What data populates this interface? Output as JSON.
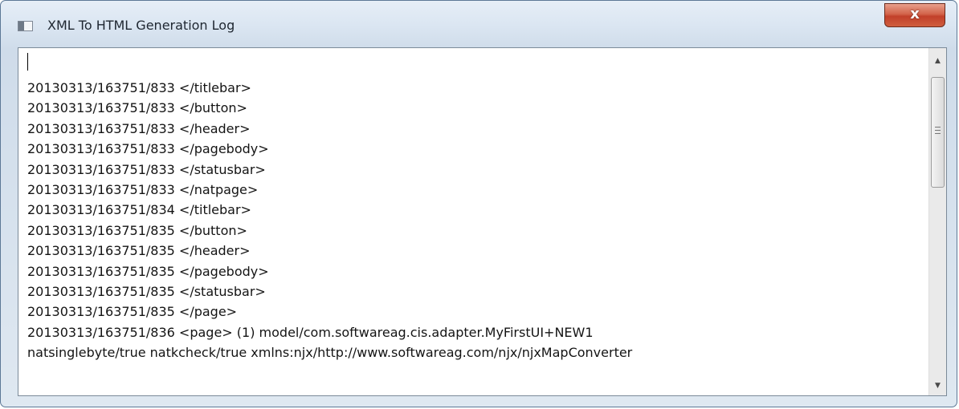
{
  "window": {
    "title": "XML To HTML Generation Log",
    "close_label": "x"
  },
  "icons": {
    "app": "window-app-icon",
    "close": "close-icon",
    "scroll_up": "scroll-up-arrow-icon",
    "scroll_down": "scroll-down-arrow-icon"
  },
  "log": {
    "lines": [
      "20130313/163751/833 </titlebar>",
      "20130313/163751/833 </button>",
      "20130313/163751/833 </header>",
      "20130313/163751/833 </pagebody>",
      "20130313/163751/833 </statusbar>",
      "20130313/163751/833 </natpage>",
      "20130313/163751/834 </titlebar>",
      "20130313/163751/835 </button>",
      "20130313/163751/835 </header>",
      "20130313/163751/835 </pagebody>",
      "20130313/163751/835 </statusbar>",
      "20130313/163751/835 </page>",
      "20130313/163751/836 <page> (1) model/com.softwareag.cis.adapter.MyFirstUI+NEW1",
      "natsinglebyte/true natkcheck/true xmlns:njx/http://www.softwareag.com/njx/njxMapConverter"
    ]
  },
  "colors": {
    "close_button": "#c7452c",
    "window_frame": "#dbe6f2",
    "text": "#141414"
  }
}
